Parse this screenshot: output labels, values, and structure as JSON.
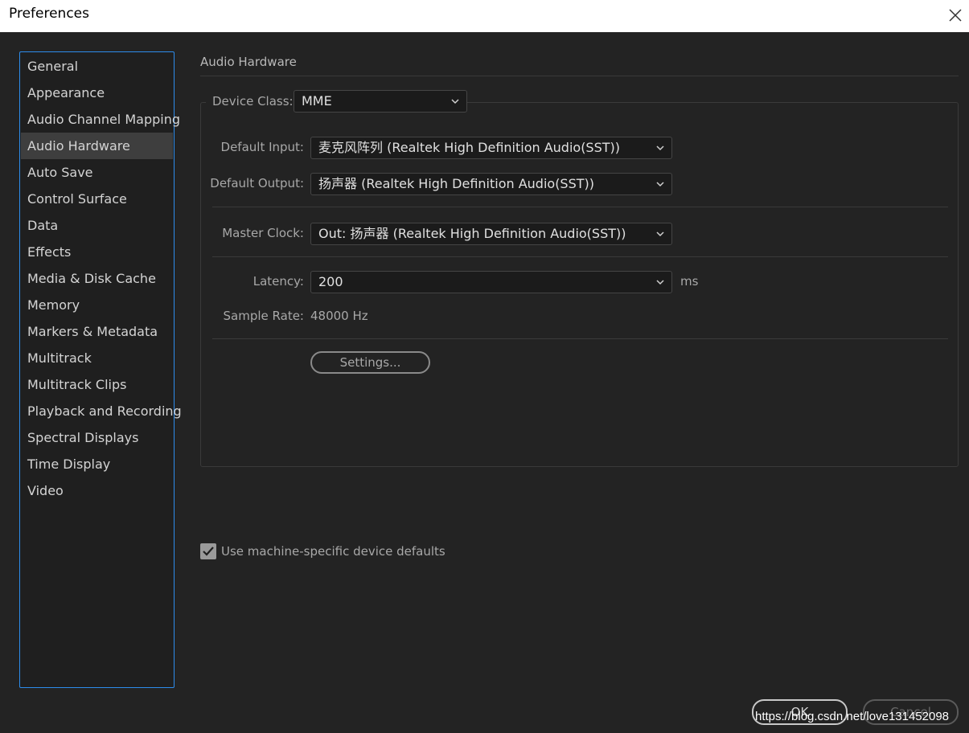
{
  "window": {
    "title": "Preferences"
  },
  "sidebar": {
    "items": [
      {
        "label": "General"
      },
      {
        "label": "Appearance"
      },
      {
        "label": "Audio Channel Mapping"
      },
      {
        "label": "Audio Hardware",
        "selected": true
      },
      {
        "label": "Auto Save"
      },
      {
        "label": "Control Surface"
      },
      {
        "label": "Data"
      },
      {
        "label": "Effects"
      },
      {
        "label": "Media & Disk Cache"
      },
      {
        "label": "Memory"
      },
      {
        "label": "Markers & Metadata"
      },
      {
        "label": "Multitrack"
      },
      {
        "label": "Multitrack Clips"
      },
      {
        "label": "Playback and Recording"
      },
      {
        "label": "Spectral Displays"
      },
      {
        "label": "Time Display"
      },
      {
        "label": "Video"
      }
    ]
  },
  "main": {
    "section_title": "Audio Hardware",
    "device_class": {
      "label": "Device Class:",
      "value": "MME"
    },
    "default_input": {
      "label": "Default Input:",
      "value": "麦克风阵列 (Realtek High Definition Audio(SST))"
    },
    "default_output": {
      "label": "Default Output:",
      "value": "扬声器 (Realtek High Definition Audio(SST))"
    },
    "master_clock": {
      "label": "Master Clock:",
      "value": "Out: 扬声器 (Realtek High Definition Audio(SST))"
    },
    "latency": {
      "label": "Latency:",
      "value": "200",
      "unit": "ms"
    },
    "sample_rate": {
      "label": "Sample Rate:",
      "value": "48000 Hz"
    },
    "settings_button": "Settings...",
    "use_machine_defaults": {
      "label": "Use machine-specific device defaults",
      "checked": true
    }
  },
  "footer": {
    "ok_label": "OK",
    "cancel_label": "Cancel"
  },
  "watermark": "https://blog.csdn.net/love131452098",
  "colors": {
    "accent": "#2d8ceb",
    "background": "#232323"
  }
}
